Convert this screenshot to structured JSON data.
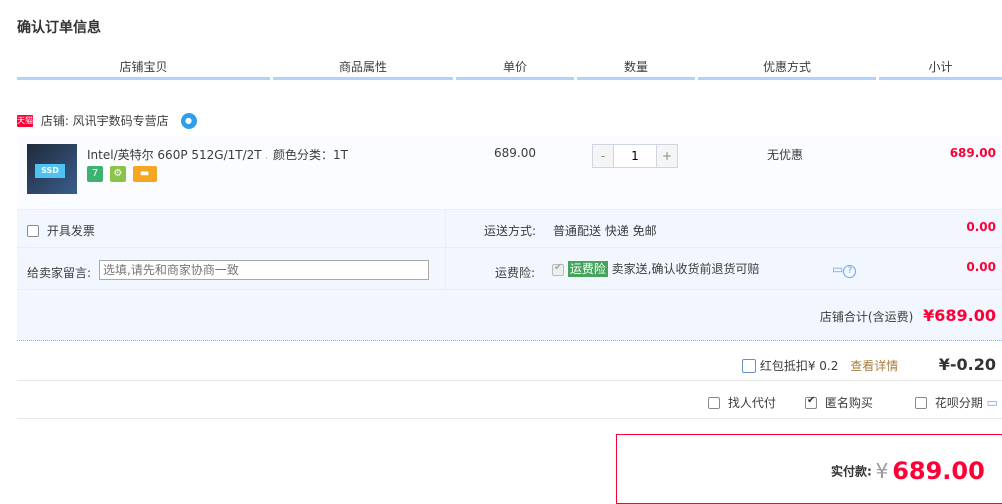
{
  "page": {
    "title": "确认订单信息"
  },
  "table_headers": [
    "店铺宝贝",
    "商品属性",
    "单价",
    "数量",
    "优惠方式",
    "小计"
  ],
  "shop": {
    "badge": "天猫",
    "name": "店铺: 风讯宇数码专营店",
    "im_icon": "wangwang-icon"
  },
  "item": {
    "title": "Intel/英特尔 660P 512G/1T/2T ...",
    "thumb_label": "SSD",
    "attribute": "颜色分类：1T",
    "price": "689.00",
    "quantity": "1",
    "qty_minus": "-",
    "qty_plus": "+",
    "promotion": "无优惠",
    "subtotal": "689.00",
    "service_icons": [
      "7",
      "⚙",
      "▬"
    ]
  },
  "invoice": {
    "label": "开具发票"
  },
  "shipping": {
    "label": "运送方式:",
    "value": "普通配送 快递 免邮",
    "amount": "0.00"
  },
  "message": {
    "label": "给卖家留言:",
    "placeholder": "选填,请先和商家协商一致"
  },
  "insurance": {
    "label": "运费险:",
    "tag": "运费险",
    "text": "卖家送,确认收货前退货可赔",
    "amount": "0.00"
  },
  "shop_total": {
    "label": "店铺合计(含运费)",
    "value": "¥689.00"
  },
  "red_packet": {
    "label": "红包抵扣¥ 0.2",
    "link": "查看详情",
    "amount": "¥-0.20"
  },
  "options": {
    "proxy": "找人代付",
    "anonymous": "匿名购买",
    "installment": "花呗分期"
  },
  "payment": {
    "label": "实付款:",
    "currency": "¥",
    "amount": "689.00"
  },
  "colors": {
    "accent": "#ff0036",
    "header_line": "#b2d1ff",
    "panel_bg": "#f2f7ff"
  }
}
